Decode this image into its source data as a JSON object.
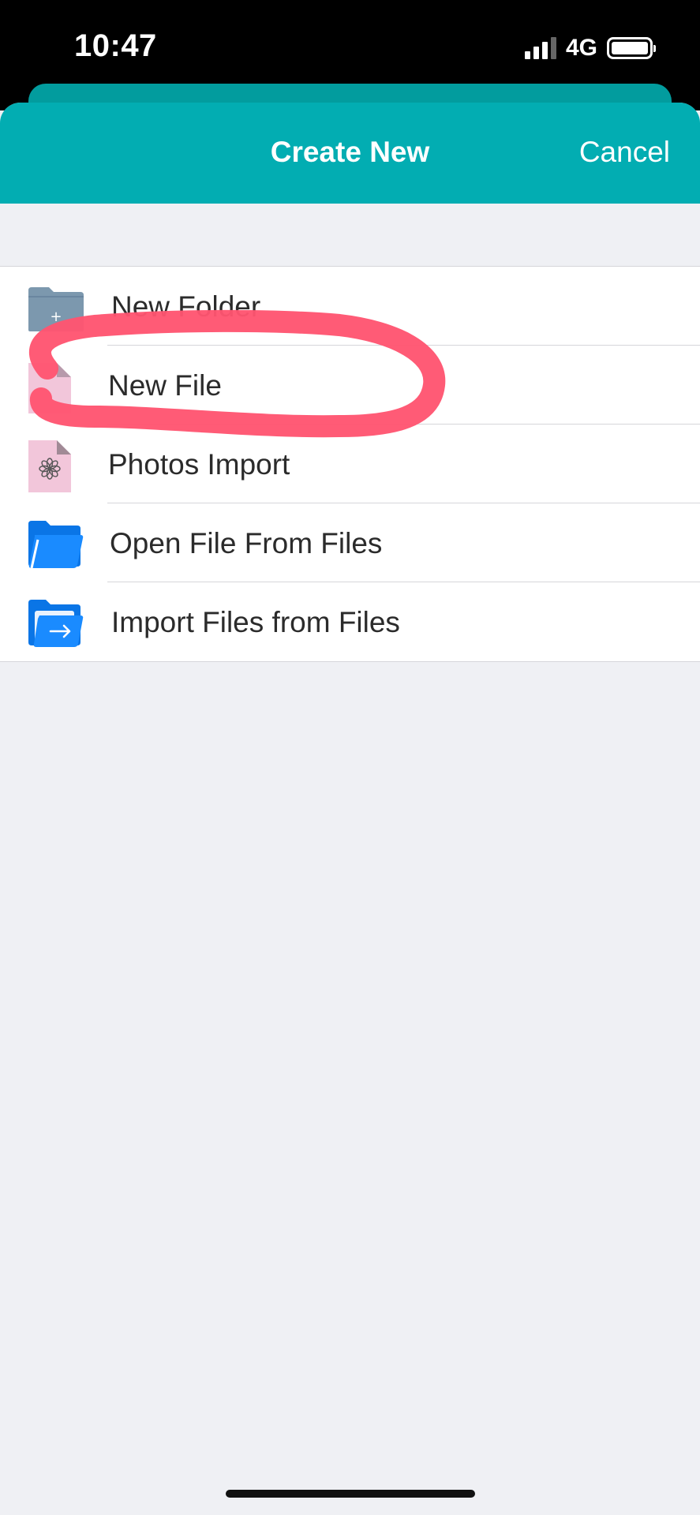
{
  "status_bar": {
    "time": "10:47",
    "network": "4G"
  },
  "header": {
    "title": "Create New",
    "cancel_label": "Cancel",
    "accent_color": "#02adb2"
  },
  "menu": {
    "items": [
      {
        "label": "New Folder",
        "icon": "folder-plus-icon"
      },
      {
        "label": "New File",
        "icon": "file-icon"
      },
      {
        "label": "Photos Import",
        "icon": "photos-icon"
      },
      {
        "label": "Open File From Files",
        "icon": "blue-folder-icon"
      },
      {
        "label": "Import Files from Files",
        "icon": "import-folder-icon"
      }
    ]
  },
  "annotation": {
    "color": "#ff5470",
    "shape": "hand-drawn circle around New File"
  }
}
